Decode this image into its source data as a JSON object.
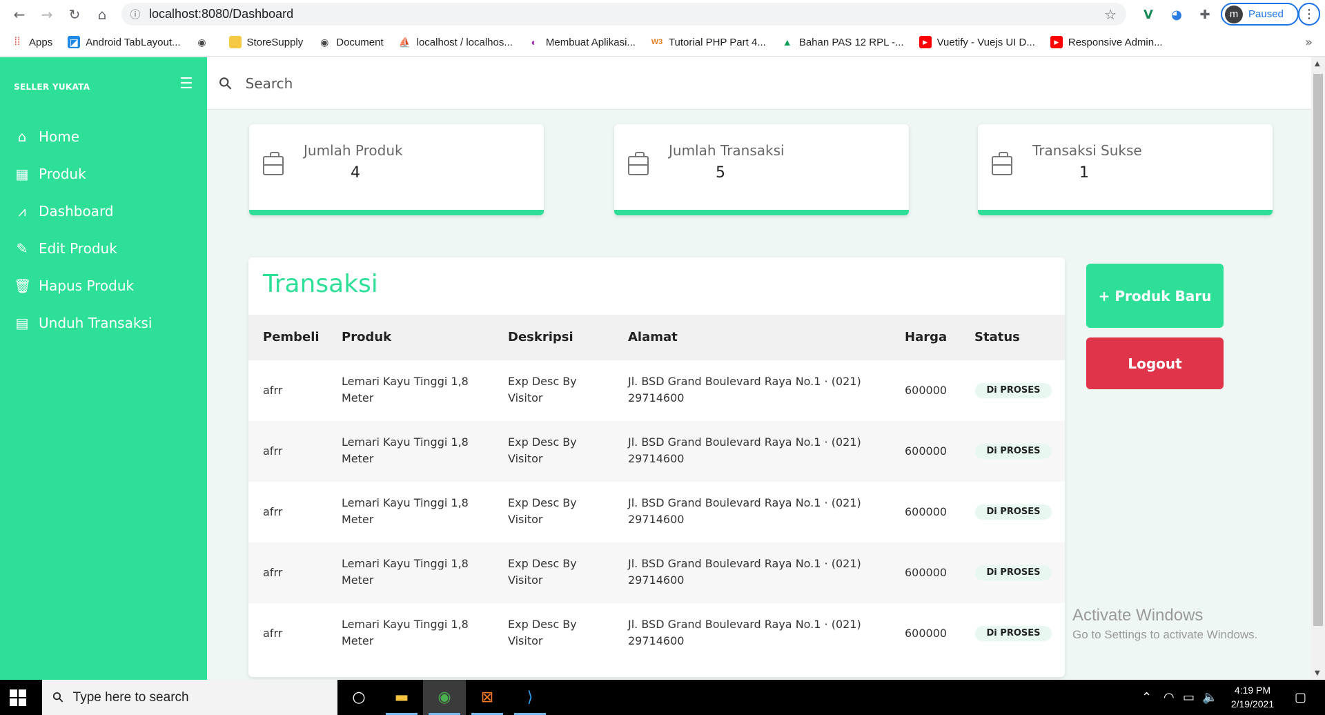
{
  "browser": {
    "url": "localhost:8080/Dashboard",
    "profile_initial": "m",
    "profile_status": "Paused",
    "bookmarks": [
      {
        "label": "Apps",
        "icon": "apps-grid-icon"
      },
      {
        "label": "Android TabLayout...",
        "icon": "android-icon"
      },
      {
        "label": "",
        "icon": "globe-icon"
      },
      {
        "label": "StoreSupply",
        "icon": "folder-icon"
      },
      {
        "label": "Document",
        "icon": "globe-icon"
      },
      {
        "label": "localhost / localhos...",
        "icon": "phpmyadmin-icon"
      },
      {
        "label": "Membuat Aplikasi...",
        "icon": "site-icon"
      },
      {
        "label": "Tutorial PHP Part 4...",
        "icon": "site-icon"
      },
      {
        "label": "Bahan PAS 12 RPL -...",
        "icon": "drive-icon"
      },
      {
        "label": "Vuetify - Vuejs UI D...",
        "icon": "youtube-icon"
      },
      {
        "label": "Responsive Admin...",
        "icon": "youtube-icon"
      }
    ],
    "more": "»"
  },
  "sidebar": {
    "brand": "SELLER YUKATA",
    "items": [
      {
        "label": "Home",
        "icon": "home-icon"
      },
      {
        "label": "Produk",
        "icon": "table-icon"
      },
      {
        "label": "Dashboard",
        "icon": "chart-line-icon"
      },
      {
        "label": "Edit Produk",
        "icon": "edit-icon"
      },
      {
        "label": "Hapus Produk",
        "icon": "trash-icon"
      },
      {
        "label": "Unduh Transaksi",
        "icon": "excel-file-icon"
      }
    ]
  },
  "search": {
    "placeholder": "Search"
  },
  "stats": [
    {
      "title": "Jumlah Produk",
      "value": "4"
    },
    {
      "title": "Jumlah Transaksi",
      "value": "5"
    },
    {
      "title": "Transaksi Sukse",
      "value": "1"
    }
  ],
  "transactions": {
    "title": "Transaksi",
    "columns": [
      "Pembeli",
      "Produk",
      "Deskripsi",
      "Alamat",
      "Harga",
      "Status"
    ],
    "rows": [
      {
        "pembeli": "afrr",
        "produk1": "Lemari Kayu Tinggi 1,8",
        "produk2": "Meter",
        "desk1": "Exp Desc By",
        "desk2": "Visitor",
        "alamat1": "Jl. BSD Grand Boulevard Raya No.1 · (021)",
        "alamat2": "29714600",
        "harga": "600000",
        "status": "Di PROSES"
      },
      {
        "pembeli": "afrr",
        "produk1": "Lemari Kayu Tinggi 1,8",
        "produk2": "Meter",
        "desk1": "Exp Desc By",
        "desk2": "Visitor",
        "alamat1": "Jl. BSD Grand Boulevard Raya No.1 · (021)",
        "alamat2": "29714600",
        "harga": "600000",
        "status": "Di PROSES"
      },
      {
        "pembeli": "afrr",
        "produk1": "Lemari Kayu Tinggi 1,8",
        "produk2": "Meter",
        "desk1": "Exp Desc By",
        "desk2": "Visitor",
        "alamat1": "Jl. BSD Grand Boulevard Raya No.1 · (021)",
        "alamat2": "29714600",
        "harga": "600000",
        "status": "Di PROSES"
      },
      {
        "pembeli": "afrr",
        "produk1": "Lemari Kayu Tinggi 1,8",
        "produk2": "Meter",
        "desk1": "Exp Desc By",
        "desk2": "Visitor",
        "alamat1": "Jl. BSD Grand Boulevard Raya No.1 · (021)",
        "alamat2": "29714600",
        "harga": "600000",
        "status": "Di PROSES"
      },
      {
        "pembeli": "afrr",
        "produk1": "Lemari Kayu Tinggi 1,8",
        "produk2": "Meter",
        "desk1": "Exp Desc By",
        "desk2": "Visitor",
        "alamat1": "Jl. BSD Grand Boulevard Raya No.1 · (021)",
        "alamat2": "29714600",
        "harga": "600000",
        "status": "Di PROSES"
      }
    ]
  },
  "actions": {
    "new_product": "+ Produk Baru",
    "logout": "Logout"
  },
  "watermark": {
    "line1": "Activate Windows",
    "line2": "Go to Settings to activate Windows."
  },
  "taskbar": {
    "search_placeholder": "Type here to search",
    "time": "4:19 PM",
    "date": "2/19/2021"
  },
  "colors": {
    "accent": "#2ddf97",
    "danger": "#e0344b"
  }
}
